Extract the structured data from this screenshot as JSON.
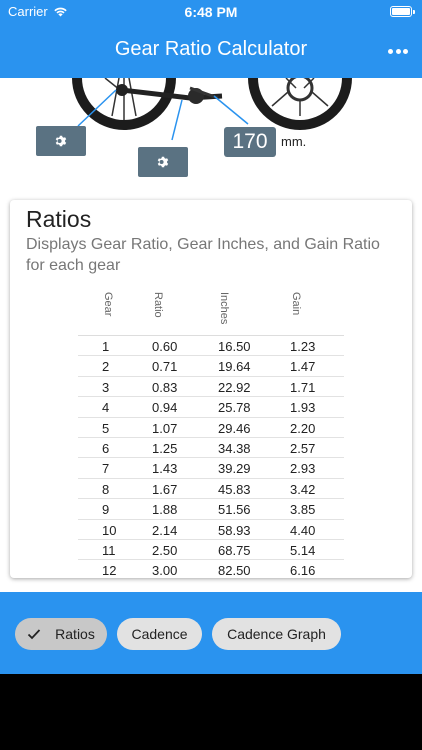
{
  "status_bar": {
    "carrier": "Carrier",
    "time": "6:48 PM"
  },
  "app_bar": {
    "title": "Gear Ratio Calculator",
    "menu_icon": "more-horizontal-icon"
  },
  "crank": {
    "value": "170",
    "unit": "mm."
  },
  "ratios": {
    "title": "Ratios",
    "subtitle": "Displays Gear Ratio, Gear Inches, and Gain Ratio for each gear",
    "columns": [
      "Gear",
      "Ratio",
      "Inches",
      "Gain"
    ],
    "rows": [
      [
        "1",
        "0.60",
        "16.50",
        "1.23"
      ],
      [
        "2",
        "0.71",
        "19.64",
        "1.47"
      ],
      [
        "3",
        "0.83",
        "22.92",
        "1.71"
      ],
      [
        "4",
        "0.94",
        "25.78",
        "1.93"
      ],
      [
        "5",
        "1.07",
        "29.46",
        "2.20"
      ],
      [
        "6",
        "1.25",
        "34.38",
        "2.57"
      ],
      [
        "7",
        "1.43",
        "39.29",
        "2.93"
      ],
      [
        "8",
        "1.67",
        "45.83",
        "3.42"
      ],
      [
        "9",
        "1.88",
        "51.56",
        "3.85"
      ],
      [
        "10",
        "2.14",
        "58.93",
        "4.40"
      ],
      [
        "11",
        "2.50",
        "68.75",
        "5.14"
      ],
      [
        "12",
        "3.00",
        "82.50",
        "6.16"
      ]
    ]
  },
  "chips": [
    {
      "label": "Ratios",
      "selected": true
    },
    {
      "label": "Cadence",
      "selected": false
    },
    {
      "label": "Cadence Graph",
      "selected": false
    }
  ],
  "colors": {
    "primary": "#2a93ef",
    "control": "#5a7282",
    "chip": "#e2e2e2",
    "chip_selected": "#c8c8c8"
  }
}
